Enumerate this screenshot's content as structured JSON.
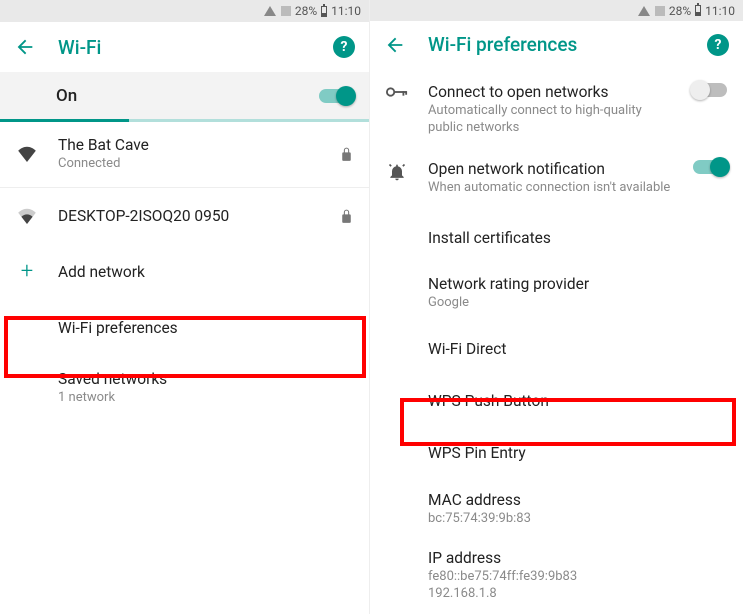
{
  "status": {
    "battery_pct": "28%",
    "time": "11:10"
  },
  "left": {
    "appbar_title": "Wi-Fi",
    "wifi_state_label": "On",
    "networks": [
      {
        "ssid": "The Bat Cave",
        "status": "Connected",
        "secured": true,
        "strength": "full"
      },
      {
        "ssid": "DESKTOP-2ISOQ20 0950",
        "status": "",
        "secured": true,
        "strength": "mid"
      }
    ],
    "add_network_label": "Add network",
    "wifi_preferences_label": "Wi-Fi preferences",
    "saved_networks_label": "Saved networks",
    "saved_networks_sub": "1 network"
  },
  "right": {
    "appbar_title": "Wi-Fi preferences",
    "items": {
      "connect_open": {
        "title": "Connect to open networks",
        "sub": "Automatically connect to high-quality public networks",
        "toggle": false
      },
      "open_notify": {
        "title": "Open network notification",
        "sub": "When automatic connection isn't available",
        "toggle": true
      },
      "install_certs": {
        "title": "Install certificates"
      },
      "rating_provider": {
        "title": "Network rating provider",
        "sub": "Google"
      },
      "wifi_direct": {
        "title": "Wi-Fi Direct"
      },
      "wps_push": {
        "title": "WPS Push Button"
      },
      "wps_pin": {
        "title": "WPS Pin Entry"
      },
      "mac": {
        "title": "MAC address",
        "sub": "bc:75:74:39:9b:83"
      },
      "ip": {
        "title": "IP address",
        "sub": "fe80::be75:74ff:fe39:9b83\n192.168.1.8"
      }
    }
  }
}
